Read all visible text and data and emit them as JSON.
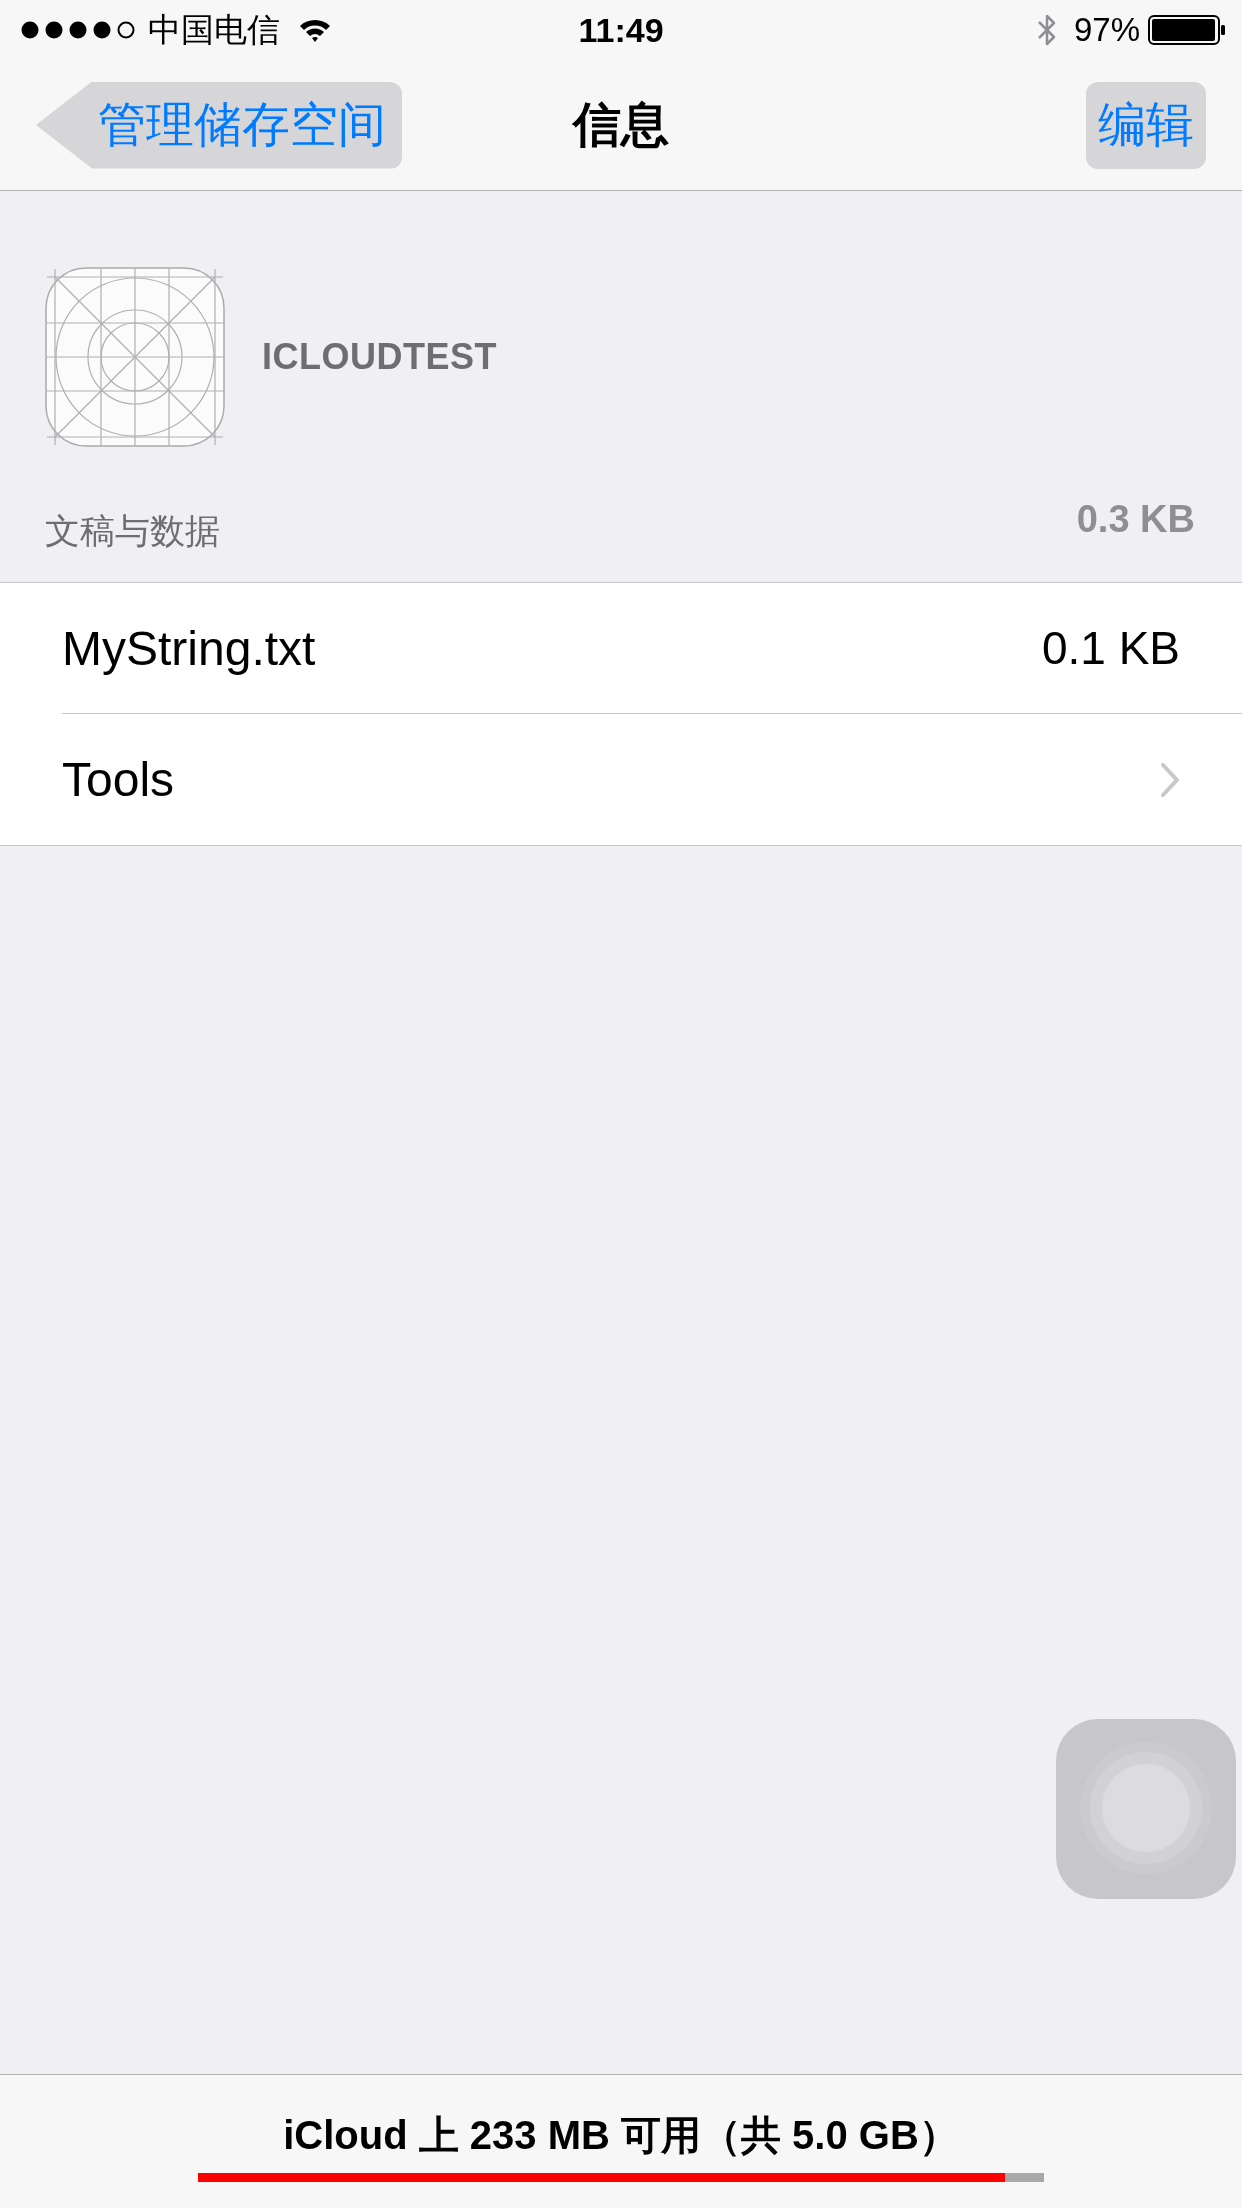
{
  "status_bar": {
    "carrier": "中国电信",
    "time": "11:49",
    "battery_percent": "97%"
  },
  "nav_bar": {
    "back_button": "管理储存空间",
    "title": "信息",
    "edit_button": "编辑"
  },
  "app": {
    "name": "ICLOUDTEST"
  },
  "section": {
    "header": "文稿与数据",
    "total": "0.3 KB"
  },
  "rows": [
    {
      "kind": "file",
      "label": "MyString.txt",
      "size": "0.1 KB"
    },
    {
      "kind": "folder",
      "label": "Tools"
    }
  ],
  "footer": {
    "storage_text": "iCloud 上 233 MB 可用（共 5.0 GB）",
    "level": 0.954
  }
}
